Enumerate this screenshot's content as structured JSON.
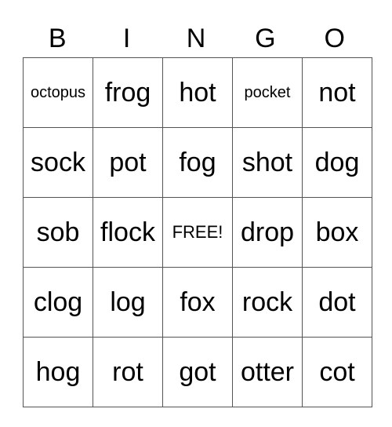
{
  "header": [
    "B",
    "I",
    "N",
    "G",
    "O"
  ],
  "rows": [
    [
      "octopus",
      "frog",
      "hot",
      "pocket",
      "not"
    ],
    [
      "sock",
      "pot",
      "fog",
      "shot",
      "dog"
    ],
    [
      "sob",
      "flock",
      "FREE!",
      "drop",
      "box"
    ],
    [
      "clog",
      "log",
      "fox",
      "rock",
      "dot"
    ],
    [
      "hog",
      "rot",
      "got",
      "otter",
      "cot"
    ]
  ]
}
